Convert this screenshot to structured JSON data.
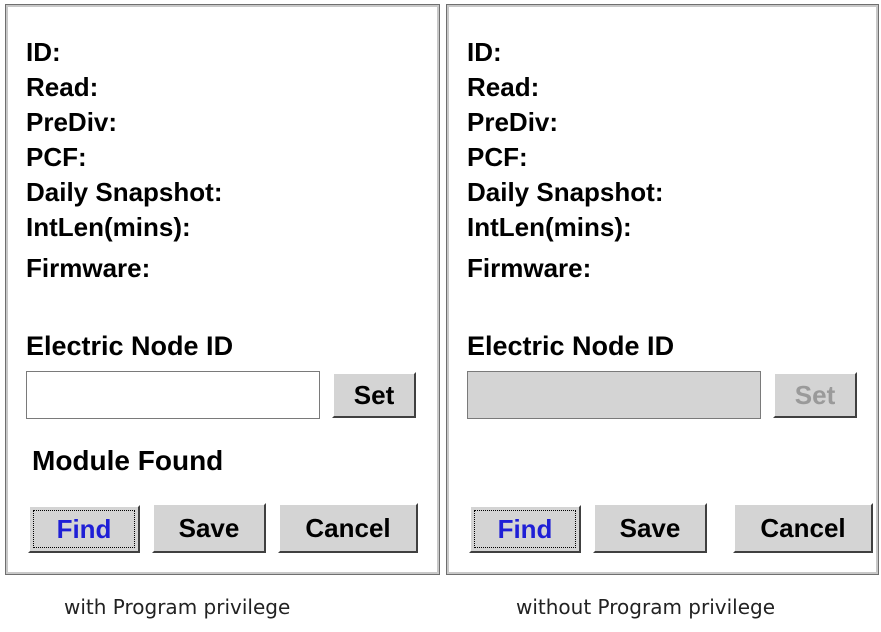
{
  "panels": [
    {
      "fields": [
        "ID:",
        "Read:",
        "PreDiv:",
        "PCF:",
        "Daily Snapshot:",
        "IntLen(mins):",
        "Firmware:"
      ],
      "node_title": "Electric Node ID",
      "node_input_value": "",
      "set_label": "Set",
      "status": "Module Found",
      "find_label": "Find",
      "save_label": "Save",
      "cancel_label": "Cancel",
      "caption": "with Program privilege"
    },
    {
      "fields": [
        "ID:",
        "Read:",
        "PreDiv:",
        "PCF:",
        "Daily Snapshot:",
        "IntLen(mins):",
        "Firmware:"
      ],
      "node_title": "Electric Node ID",
      "node_input_value": "",
      "set_label": "Set",
      "status": "",
      "find_label": "Find",
      "save_label": "Save",
      "cancel_label": "Cancel",
      "caption": "without Program privilege"
    }
  ],
  "colors": {
    "focus_text": "#1f1fd6",
    "disabled_text": "#9a9a9a",
    "button_face": "#d4d4d4"
  }
}
